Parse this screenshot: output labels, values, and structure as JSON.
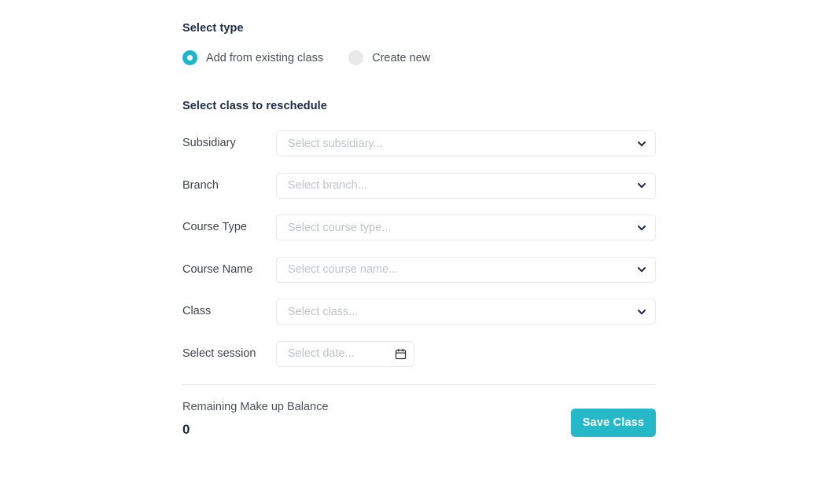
{
  "select_type": {
    "heading": "Select type",
    "options": [
      {
        "label": "Add from existing class",
        "selected": true
      },
      {
        "label": "Create new",
        "selected": false
      }
    ]
  },
  "select_class": {
    "heading": "Select class to reschedule",
    "fields": [
      {
        "label": "Subsidiary",
        "placeholder": "Select subsidiary...",
        "value": "",
        "control": "select"
      },
      {
        "label": "Branch",
        "placeholder": "Select branch...",
        "value": "",
        "control": "select"
      },
      {
        "label": "Course Type",
        "placeholder": "Select course type...",
        "value": "",
        "control": "select"
      },
      {
        "label": "Course Name",
        "placeholder": "Select course name...",
        "value": "",
        "control": "select"
      },
      {
        "label": "Class",
        "placeholder": "Select class...",
        "value": "",
        "control": "select"
      },
      {
        "label": "Select session",
        "placeholder": "Select date...",
        "value": "",
        "control": "date"
      }
    ]
  },
  "footer": {
    "balance_label": "Remaining Make up Balance",
    "balance_value": "0",
    "save_label": "Save Class"
  },
  "icons": {
    "chevron": "chevron-down-icon",
    "calendar": "calendar-icon"
  },
  "colors": {
    "accent": "#25b8c9",
    "radio_selected": "#1cb5c9",
    "radio_unselected": "#e8e8e8",
    "heading": "#1b2a4a",
    "label": "#3f444b",
    "placeholder": "#bfc3c9",
    "border": "#e9eaec",
    "background": "#ffffff"
  }
}
